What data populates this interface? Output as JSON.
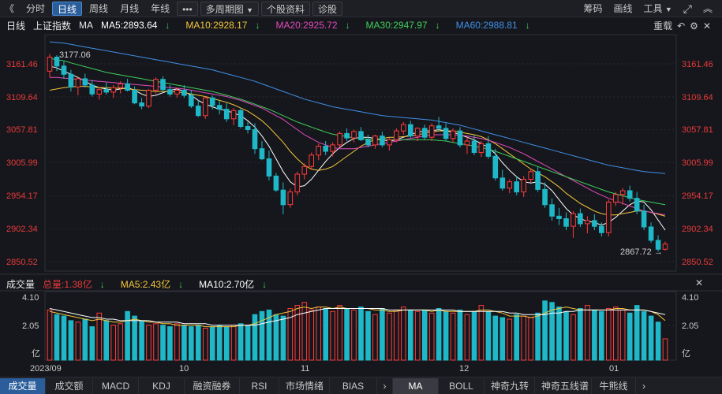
{
  "toolbar": {
    "back": "《",
    "items": [
      "分时",
      "日线",
      "周线",
      "月线",
      "年线"
    ],
    "active_index": 1,
    "more": "•••",
    "multi_period": "多周期图",
    "stock_info": "个股资料",
    "diagnose": "诊股",
    "right_items": [
      "筹码",
      "画线",
      "工具"
    ]
  },
  "info": {
    "period": "日线",
    "index_name": "上证指数",
    "ma_label": "MA",
    "ma5": "MA5:2893.64",
    "ma10": "MA10:2928.17",
    "ma20": "MA20:2925.72",
    "ma30": "MA30:2947.97",
    "ma60": "MA60:2988.81",
    "reload": "重载"
  },
  "volume_info": {
    "title": "成交量",
    "total": "总量:1.38亿",
    "ma5": "MA5:2.43亿",
    "ma10": "MA10:2.70亿"
  },
  "price_axis": {
    "labels": [
      "3161.46",
      "3109.64",
      "3057.81",
      "3005.99",
      "2954.17",
      "2902.34",
      "2850.52"
    ]
  },
  "volume_axis": {
    "labels": [
      "4.10",
      "2.05",
      "亿"
    ]
  },
  "date_axis": {
    "labels": [
      "2023/09",
      "10",
      "11",
      "12",
      "01"
    ]
  },
  "annotations": {
    "high": "3177.06",
    "low": "2867.72"
  },
  "tabs": [
    "成交量",
    "成交额",
    "MACD",
    "KDJ",
    "融资融券",
    "RSI",
    "市场情绪",
    "BIAS"
  ],
  "tabs2": [
    "MA",
    "BOLL",
    "神奇九转",
    "神奇五线谱",
    "牛熊线"
  ],
  "colors": {
    "up": "#ff3b3b",
    "down": "#1fb8c8",
    "ma5": "#ffffff",
    "ma10": "#f3c53a",
    "ma20": "#e04bbd",
    "ma30": "#3fcf5b",
    "ma60": "#3f8fe6",
    "label_red": "#e83a3a"
  },
  "chart_data": {
    "type": "candlestick",
    "ylim": [
      2850.52,
      3161.46
    ],
    "y_ticks": [
      3161.46,
      3109.64,
      3057.81,
      3005.99,
      2954.17,
      2902.34,
      2850.52
    ],
    "candles": [
      [
        3150,
        3177,
        3140,
        3172
      ],
      [
        3172,
        3175,
        3150,
        3158
      ],
      [
        3158,
        3165,
        3138,
        3145
      ],
      [
        3145,
        3152,
        3118,
        3125
      ],
      [
        3125,
        3140,
        3112,
        3138
      ],
      [
        3138,
        3146,
        3124,
        3128
      ],
      [
        3128,
        3136,
        3110,
        3114
      ],
      [
        3114,
        3125,
        3105,
        3121
      ],
      [
        3121,
        3132,
        3113,
        3117
      ],
      [
        3117,
        3128,
        3108,
        3124
      ],
      [
        3124,
        3134,
        3115,
        3130
      ],
      [
        3130,
        3138,
        3118,
        3120
      ],
      [
        3120,
        3126,
        3098,
        3100
      ],
      [
        3100,
        3108,
        3090,
        3095
      ],
      [
        3095,
        3122,
        3092,
        3120
      ],
      [
        3120,
        3140,
        3115,
        3137
      ],
      [
        3137,
        3142,
        3118,
        3121
      ],
      [
        3121,
        3128,
        3110,
        3114
      ],
      [
        3114,
        3124,
        3108,
        3120
      ],
      [
        3120,
        3128,
        3108,
        3112
      ],
      [
        3112,
        3120,
        3092,
        3095
      ],
      [
        3095,
        3104,
        3078,
        3080
      ],
      [
        3080,
        3110,
        3075,
        3108
      ],
      [
        3108,
        3112,
        3090,
        3096
      ],
      [
        3096,
        3104,
        3082,
        3090
      ],
      [
        3090,
        3100,
        3070,
        3075
      ],
      [
        3075,
        3092,
        3065,
        3088
      ],
      [
        3088,
        3092,
        3060,
        3063
      ],
      [
        3063,
        3070,
        3052,
        3058
      ],
      [
        3058,
        3068,
        3020,
        3028
      ],
      [
        3028,
        3040,
        3010,
        3012
      ],
      [
        3012,
        3025,
        2978,
        2985
      ],
      [
        2985,
        2990,
        2960,
        2963
      ],
      [
        2963,
        2975,
        2925,
        2940
      ],
      [
        2940,
        2965,
        2935,
        2960
      ],
      [
        2960,
        2992,
        2955,
        2988
      ],
      [
        2988,
        3005,
        2980,
        3000
      ],
      [
        3000,
        3022,
        2995,
        3018
      ],
      [
        3018,
        3036,
        3010,
        3032
      ],
      [
        3032,
        3040,
        3018,
        3024
      ],
      [
        3024,
        3038,
        3016,
        3034
      ],
      [
        3034,
        3055,
        3030,
        3052
      ],
      [
        3052,
        3060,
        3040,
        3045
      ],
      [
        3045,
        3058,
        3038,
        3055
      ],
      [
        3055,
        3062,
        3040,
        3042
      ],
      [
        3042,
        3050,
        3030,
        3034
      ],
      [
        3034,
        3050,
        3028,
        3048
      ],
      [
        3048,
        3055,
        3030,
        3034
      ],
      [
        3034,
        3045,
        3025,
        3042
      ],
      [
        3042,
        3060,
        3038,
        3056
      ],
      [
        3056,
        3070,
        3050,
        3066
      ],
      [
        3066,
        3072,
        3045,
        3048
      ],
      [
        3048,
        3062,
        3040,
        3060
      ],
      [
        3060,
        3066,
        3042,
        3046
      ],
      [
        3046,
        3068,
        3040,
        3064
      ],
      [
        3064,
        3078,
        3055,
        3060
      ],
      [
        3060,
        3068,
        3040,
        3044
      ],
      [
        3044,
        3060,
        3038,
        3056
      ],
      [
        3056,
        3062,
        3030,
        3034
      ],
      [
        3034,
        3046,
        3020,
        3040
      ],
      [
        3040,
        3050,
        3018,
        3022
      ],
      [
        3022,
        3040,
        3015,
        3036
      ],
      [
        3036,
        3048,
        3012,
        3016
      ],
      [
        3016,
        3028,
        2978,
        2982
      ],
      [
        2982,
        2995,
        2962,
        2966
      ],
      [
        2966,
        2980,
        2958,
        2976
      ],
      [
        2976,
        2985,
        2955,
        2960
      ],
      [
        2960,
        2985,
        2952,
        2980
      ],
      [
        2980,
        2996,
        2975,
        2992
      ],
      [
        2992,
        3000,
        2960,
        2964
      ],
      [
        2964,
        2975,
        2935,
        2940
      ],
      [
        2940,
        2950,
        2915,
        2922
      ],
      [
        2922,
        2935,
        2908,
        2918
      ],
      [
        2918,
        2928,
        2900,
        2906
      ],
      [
        2906,
        2930,
        2888,
        2926
      ],
      [
        2926,
        2934,
        2905,
        2910
      ],
      [
        2910,
        2922,
        2895,
        2915
      ],
      [
        2915,
        2925,
        2900,
        2906
      ],
      [
        2906,
        2912,
        2890,
        2896
      ],
      [
        2896,
        2948,
        2890,
        2944
      ],
      [
        2944,
        2960,
        2938,
        2956
      ],
      [
        2956,
        2966,
        2940,
        2962
      ],
      [
        2962,
        2970,
        2945,
        2950
      ],
      [
        2950,
        2960,
        2925,
        2930
      ],
      [
        2930,
        2940,
        2900,
        2905
      ],
      [
        2905,
        2912,
        2880,
        2884
      ],
      [
        2884,
        2892,
        2866,
        2870
      ],
      [
        2870,
        2882,
        2868,
        2878
      ]
    ],
    "ma": {
      "ma5": [
        3158,
        3155,
        3150,
        3145,
        3140,
        3134,
        3128,
        3124,
        3122,
        3120,
        3122,
        3124,
        3120,
        3114,
        3110,
        3112,
        3116,
        3120,
        3122,
        3118,
        3112,
        3104,
        3098,
        3094,
        3090,
        3088,
        3084,
        3080,
        3072,
        3062,
        3048,
        3032,
        3012,
        2992,
        2976,
        2968,
        2970,
        2980,
        2994,
        3008,
        3020,
        3030,
        3038,
        3044,
        3046,
        3046,
        3044,
        3042,
        3040,
        3042,
        3046,
        3050,
        3054,
        3056,
        3056,
        3058,
        3056,
        3054,
        3050,
        3046,
        3042,
        3036,
        3030,
        3020,
        3006,
        2994,
        2984,
        2976,
        2974,
        2976,
        2972,
        2962,
        2948,
        2934,
        2924,
        2918,
        2914,
        2912,
        2908,
        2912,
        2920,
        2930,
        2940,
        2946,
        2944,
        2932,
        2916,
        2900
      ],
      "ma10": [
        3120,
        3122,
        3124,
        3125,
        3126,
        3126,
        3125,
        3124,
        3124,
        3123,
        3123,
        3122,
        3121,
        3120,
        3119,
        3118,
        3118,
        3118,
        3117,
        3116,
        3114,
        3112,
        3110,
        3107,
        3104,
        3101,
        3097,
        3092,
        3087,
        3080,
        3072,
        3062,
        3050,
        3038,
        3024,
        3012,
        3002,
        2996,
        2994,
        2996,
        3000,
        3008,
        3016,
        3024,
        3032,
        3038,
        3042,
        3044,
        3046,
        3046,
        3047,
        3048,
        3050,
        3052,
        3054,
        3056,
        3056,
        3056,
        3054,
        3052,
        3050,
        3047,
        3042,
        3036,
        3028,
        3020,
        3012,
        3004,
        2996,
        2990,
        2984,
        2976,
        2968,
        2958,
        2950,
        2942,
        2936,
        2930,
        2926,
        2924,
        2924,
        2926,
        2928,
        2930,
        2930,
        2928,
        2925,
        2922
      ],
      "ma20": [
        3140,
        3140,
        3139,
        3138,
        3137,
        3136,
        3135,
        3134,
        3133,
        3132,
        3131,
        3130,
        3129,
        3128,
        3127,
        3126,
        3125,
        3124,
        3123,
        3122,
        3120,
        3118,
        3116,
        3114,
        3112,
        3110,
        3107,
        3104,
        3100,
        3096,
        3092,
        3086,
        3080,
        3074,
        3066,
        3058,
        3050,
        3044,
        3038,
        3034,
        3030,
        3028,
        3028,
        3028,
        3030,
        3032,
        3034,
        3036,
        3038,
        3040,
        3042,
        3044,
        3046,
        3048,
        3050,
        3050,
        3050,
        3050,
        3049,
        3048,
        3046,
        3044,
        3041,
        3038,
        3034,
        3030,
        3025,
        3020,
        3014,
        3008,
        3002,
        2996,
        2990,
        2984,
        2978,
        2972,
        2966,
        2960,
        2955,
        2950,
        2946,
        2942,
        2938,
        2934,
        2930,
        2928,
        2926,
        2924
      ],
      "ma30": [
        3170,
        3168,
        3166,
        3163,
        3160,
        3157,
        3154,
        3151,
        3148,
        3146,
        3144,
        3142,
        3140,
        3138,
        3136,
        3134,
        3132,
        3130,
        3128,
        3126,
        3124,
        3122,
        3120,
        3118,
        3115,
        3112,
        3109,
        3106,
        3102,
        3098,
        3094,
        3090,
        3085,
        3080,
        3075,
        3070,
        3066,
        3062,
        3058,
        3054,
        3051,
        3049,
        3047,
        3045,
        3044,
        3043,
        3042,
        3042,
        3042,
        3042,
        3042,
        3042,
        3042,
        3042,
        3042,
        3041,
        3040,
        3038,
        3036,
        3034,
        3032,
        3030,
        3027,
        3024,
        3020,
        3016,
        3012,
        3008,
        3004,
        3000,
        2996,
        2992,
        2988,
        2984,
        2980,
        2976,
        2972,
        2968,
        2964,
        2960,
        2957,
        2954,
        2951,
        2948,
        2946,
        2944,
        2942,
        2940
      ],
      "ma60": [
        3196,
        3195,
        3194,
        3192,
        3190,
        3188,
        3186,
        3184,
        3182,
        3180,
        3178,
        3176,
        3174,
        3172,
        3170,
        3168,
        3166,
        3164,
        3162,
        3160,
        3158,
        3156,
        3154,
        3152,
        3149,
        3146,
        3143,
        3140,
        3137,
        3134,
        3130,
        3126,
        3122,
        3118,
        3114,
        3110,
        3106,
        3103,
        3100,
        3097,
        3094,
        3092,
        3090,
        3088,
        3086,
        3084,
        3082,
        3080,
        3079,
        3078,
        3077,
        3076,
        3075,
        3074,
        3073,
        3071,
        3069,
        3067,
        3065,
        3062,
        3059,
        3056,
        3053,
        3050,
        3047,
        3044,
        3041,
        3038,
        3035,
        3032,
        3029,
        3026,
        3023,
        3020,
        3017,
        3014,
        3011,
        3008,
        3005,
        3002,
        3000,
        2998,
        2996,
        2994,
        2992,
        2991,
        2990,
        2989
      ]
    },
    "volume": {
      "ylim": [
        0,
        4.1
      ],
      "values": [
        3.3,
        3.0,
        2.9,
        2.6,
        2.5,
        2.7,
        2.2,
        3.1,
        2.6,
        2.3,
        2.4,
        3.2,
        2.9,
        2.6,
        2.3,
        2.4,
        2.3,
        2.2,
        2.4,
        2.3,
        2.2,
        2.3,
        2.1,
        2.2,
        2.3,
        2.2,
        2.3,
        2.4,
        2.3,
        3.0,
        3.2,
        3.3,
        3.0,
        2.9,
        3.4,
        3.6,
        3.8,
        3.3,
        3.5,
        3.4,
        3.2,
        3.6,
        3.4,
        3.3,
        3.5,
        3.2,
        3.0,
        3.4,
        3.1,
        3.3,
        3.5,
        3.3,
        3.2,
        3.3,
        3.1,
        3.4,
        3.2,
        3.1,
        3.3,
        3.0,
        3.2,
        3.6,
        3.2,
        2.9,
        2.8,
        2.7,
        3.0,
        2.9,
        2.8,
        3.1,
        3.9,
        3.8,
        3.5,
        3.2,
        3.0,
        3.4,
        3.6,
        3.3,
        3.2,
        3.4,
        3.5,
        3.3,
        3.1,
        3.6,
        3.2,
        2.9,
        2.5,
        1.4
      ],
      "ma5": [
        3.2,
        3.1,
        3.0,
        2.9,
        2.8,
        2.7,
        2.6,
        2.7,
        2.6,
        2.5,
        2.5,
        2.6,
        2.7,
        2.6,
        2.5,
        2.5,
        2.4,
        2.4,
        2.3,
        2.3,
        2.3,
        2.3,
        2.2,
        2.2,
        2.2,
        2.2,
        2.2,
        2.3,
        2.3,
        2.4,
        2.6,
        2.8,
        3.0,
        3.1,
        3.2,
        3.4,
        3.5,
        3.4,
        3.5,
        3.5,
        3.4,
        3.5,
        3.4,
        3.4,
        3.4,
        3.4,
        3.3,
        3.3,
        3.2,
        3.2,
        3.3,
        3.3,
        3.3,
        3.3,
        3.2,
        3.3,
        3.2,
        3.2,
        3.2,
        3.2,
        3.2,
        3.3,
        3.3,
        3.2,
        3.1,
        2.9,
        2.9,
        2.9,
        2.8,
        2.9,
        3.1,
        3.3,
        3.4,
        3.5,
        3.4,
        3.3,
        3.3,
        3.3,
        3.3,
        3.3,
        3.4,
        3.4,
        3.3,
        3.3,
        3.3,
        3.2,
        3.0,
        2.6
      ],
      "ma10": [
        3.4,
        3.3,
        3.2,
        3.1,
        3.0,
        2.9,
        2.8,
        2.8,
        2.7,
        2.7,
        2.6,
        2.6,
        2.6,
        2.6,
        2.6,
        2.5,
        2.5,
        2.5,
        2.5,
        2.4,
        2.4,
        2.4,
        2.4,
        2.3,
        2.3,
        2.3,
        2.3,
        2.3,
        2.3,
        2.3,
        2.4,
        2.5,
        2.6,
        2.7,
        2.8,
        3.0,
        3.1,
        3.2,
        3.3,
        3.4,
        3.4,
        3.4,
        3.4,
        3.4,
        3.4,
        3.4,
        3.4,
        3.4,
        3.3,
        3.3,
        3.3,
        3.3,
        3.3,
        3.3,
        3.3,
        3.3,
        3.3,
        3.3,
        3.2,
        3.2,
        3.2,
        3.2,
        3.2,
        3.2,
        3.2,
        3.1,
        3.1,
        3.0,
        3.0,
        3.0,
        3.0,
        3.1,
        3.1,
        3.2,
        3.2,
        3.3,
        3.3,
        3.3,
        3.3,
        3.3,
        3.3,
        3.3,
        3.3,
        3.3,
        3.3,
        3.2,
        3.1,
        3.0
      ]
    }
  }
}
